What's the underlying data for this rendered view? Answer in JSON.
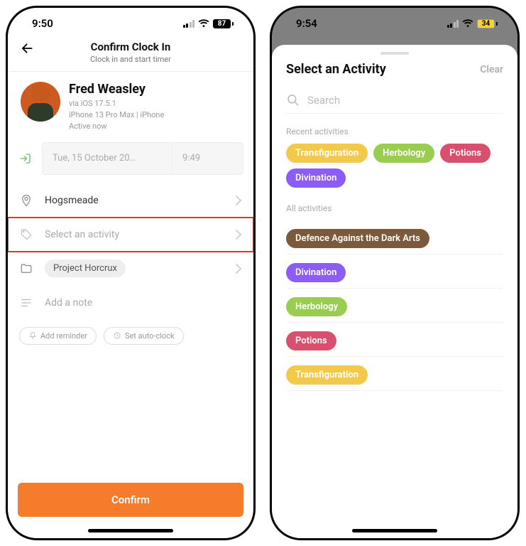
{
  "left": {
    "status": {
      "time": "9:50",
      "battery": "87"
    },
    "header": {
      "title": "Confirm Clock In",
      "subtitle": "Clock in and start timer"
    },
    "user": {
      "name": "Fred Weasley",
      "os": "via iOS 17.5.1",
      "device": "iPhone 13 Pro Max | iPhone",
      "activity": "Active now"
    },
    "datetime": {
      "date": "Tue, 15 October 20…",
      "time": "9:49"
    },
    "location": "Hogsmeade",
    "activity_placeholder": "Select an activity",
    "project_chip": "Project Horcrux",
    "note_placeholder": "Add a note",
    "add_reminder": "Add reminder",
    "set_auto_clock": "Set auto-clock",
    "confirm": "Confirm"
  },
  "right": {
    "status": {
      "time": "9:54",
      "battery": "34"
    },
    "sheet_title": "Select an Activity",
    "clear": "Clear",
    "search_placeholder": "Search",
    "recent_label": "Recent activities",
    "recent": [
      {
        "name": "Transfiguration",
        "color": "c-yellow"
      },
      {
        "name": "Herbology",
        "color": "c-green"
      },
      {
        "name": "Potions",
        "color": "c-pink"
      },
      {
        "name": "Divination",
        "color": "c-purple"
      }
    ],
    "all_label": "All activities",
    "all": [
      {
        "name": "Defence Against the Dark Arts",
        "color": "c-brown"
      },
      {
        "name": "Divination",
        "color": "c-purple"
      },
      {
        "name": "Herbology",
        "color": "c-green"
      },
      {
        "name": "Potions",
        "color": "c-pink"
      },
      {
        "name": "Transfiguration",
        "color": "c-yellow"
      }
    ]
  }
}
